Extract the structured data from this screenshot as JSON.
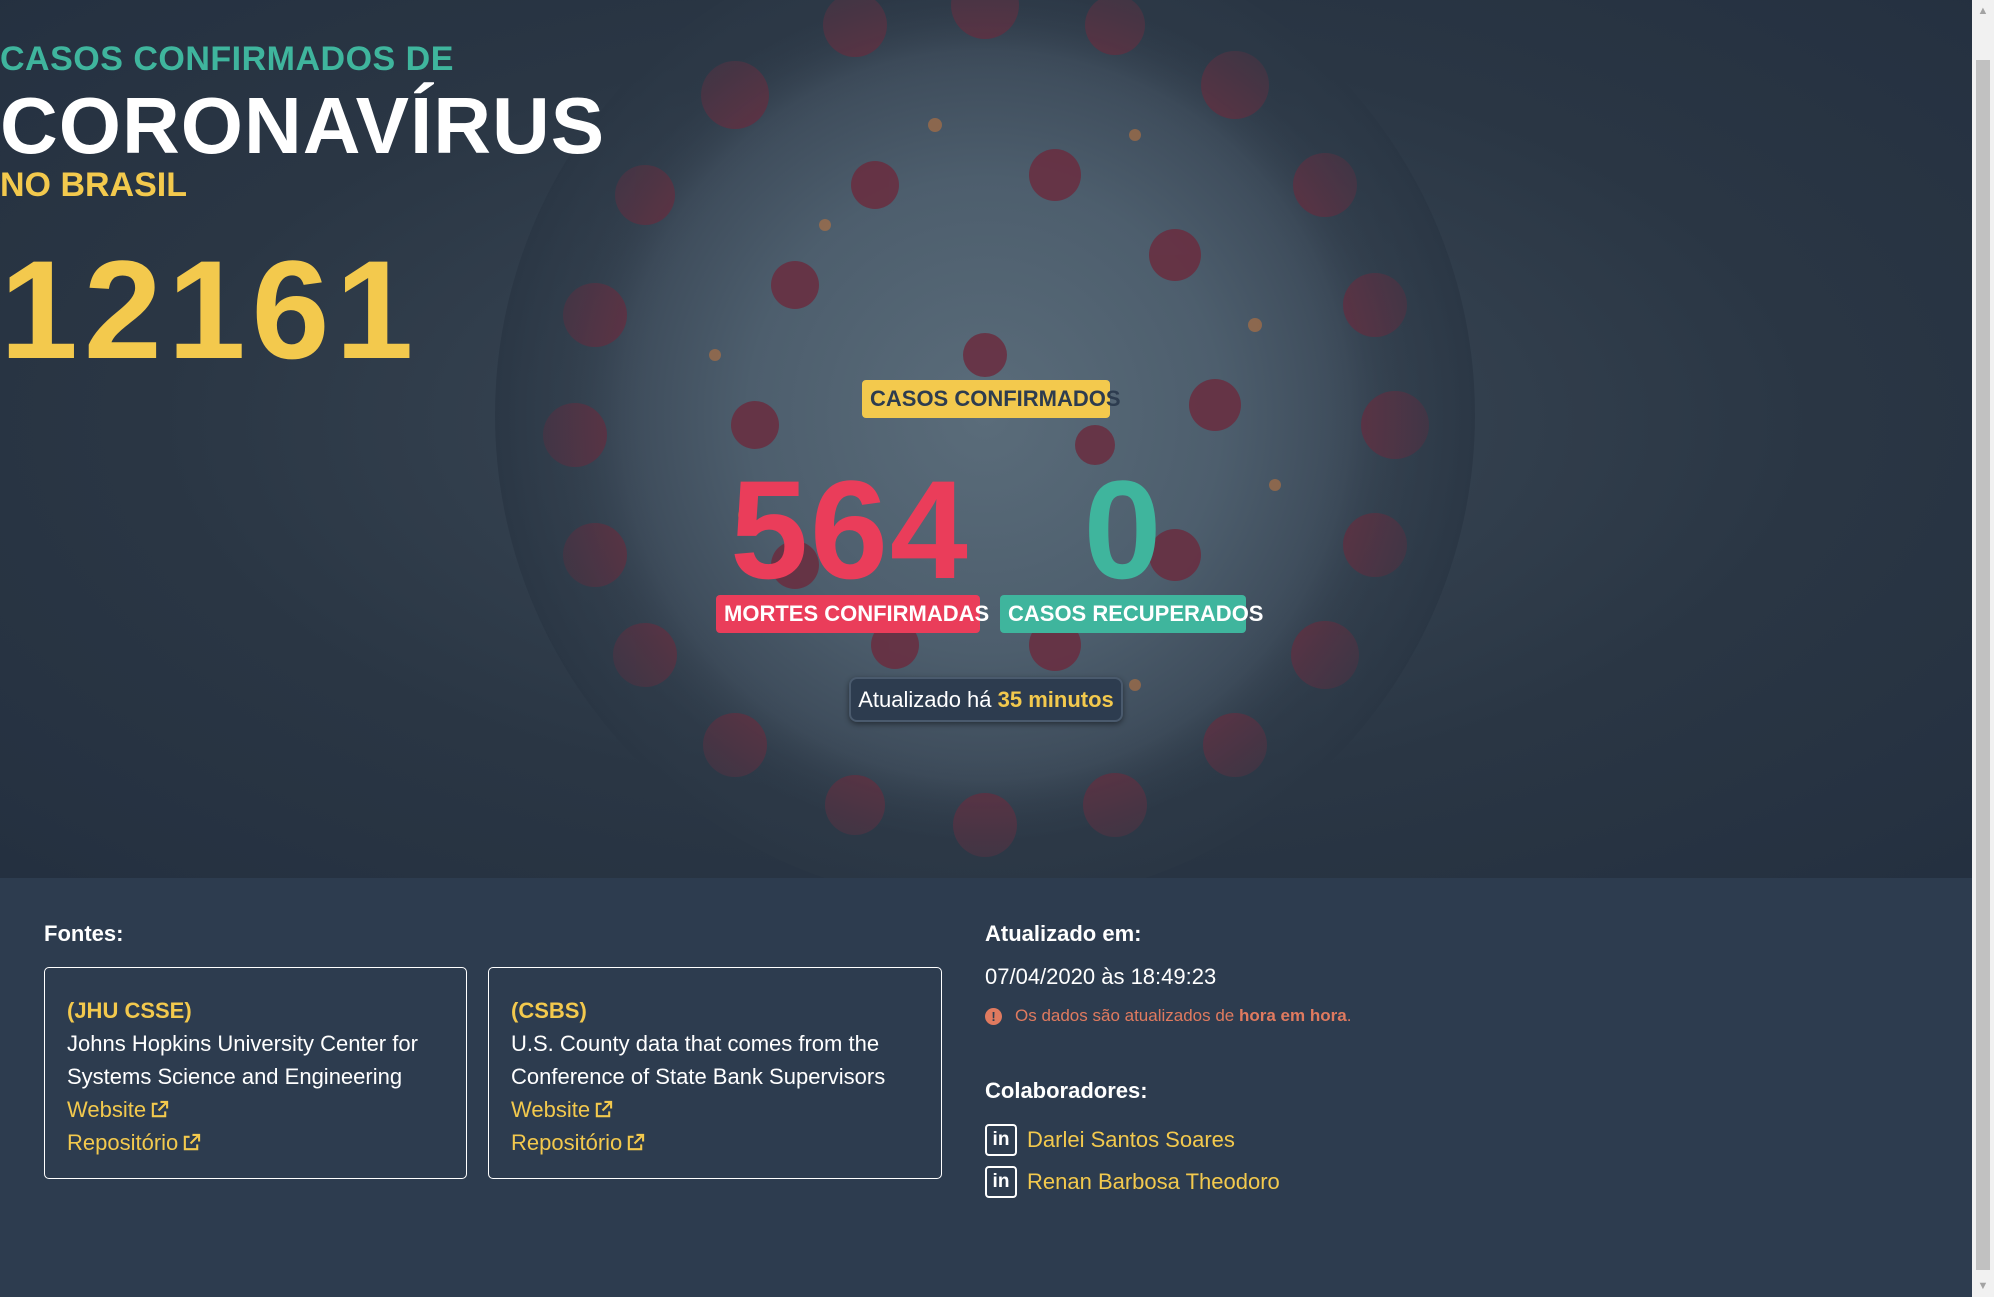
{
  "hero": {
    "subtitle_top": "CASOS CONFIRMADOS DE",
    "title": "CORONAVÍRUS",
    "subtitle_bottom": "NO BRASIL",
    "confirmed_value": "12161",
    "confirmed_label": "CASOS CONFIRMADOS",
    "deaths_value": "564",
    "deaths_label": "MORTES CONFIRMADAS",
    "recovered_value": "0",
    "recovered_label": "CASOS RECUPERADOS",
    "updated_prefix": "Atualizado há",
    "updated_value": "35 minutos"
  },
  "colors": {
    "yellow": "#f3c94d",
    "red": "#ea3d5a",
    "teal": "#3fb59d",
    "background": "#2d3c4f",
    "orange_note": "#e07a5f"
  },
  "footer": {
    "sources_label": "Fontes:",
    "sources": [
      {
        "code": "(JHU CSSE)",
        "name": "Johns Hopkins University Center for Systems Science and Engineering",
        "website_label": "Website",
        "repo_label": "Repositório",
        "icon": "external-link-icon"
      },
      {
        "code": "(CSBS)",
        "name": "U.S. County data that comes from the Conference of State Bank Supervisors",
        "website_label": "Website",
        "repo_label": "Repositório",
        "icon": "external-link-icon"
      }
    ],
    "updated_label": "Atualizado em:",
    "updated_date": "07/04/2020 às 18:49:23",
    "note_prefix": "Os dados são atualizados de",
    "note_bold": "hora em hora",
    "note_suffix": ".",
    "collaborators_label": "Colaboradores:",
    "collaborators": [
      {
        "name": "Darlei Santos Soares",
        "icon": "linkedin-icon",
        "icon_text": "in"
      },
      {
        "name": "Renan Barbosa Theodoro",
        "icon": "linkedin-icon",
        "icon_text": "in"
      }
    ]
  }
}
